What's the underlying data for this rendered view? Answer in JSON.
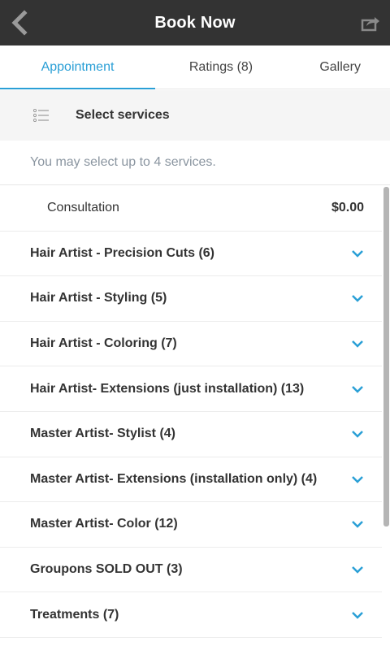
{
  "header": {
    "title": "Book Now"
  },
  "tabs": [
    {
      "label": "Appointment",
      "active": true
    },
    {
      "label": "Ratings (8)",
      "active": false
    },
    {
      "label": "Gallery",
      "active": false
    }
  ],
  "section": {
    "label": "Select services"
  },
  "hint": "You may select up to 4 services.",
  "consultation": {
    "name": "Consultation",
    "price": "$0.00"
  },
  "groups": [
    {
      "label": "Hair Artist - Precision Cuts (6)"
    },
    {
      "label": "Hair Artist - Styling (5)"
    },
    {
      "label": "Hair Artist - Coloring (7)"
    },
    {
      "label": "Hair Artist- Extensions (just installation) (13)"
    },
    {
      "label": "Master Artist- Stylist (4)"
    },
    {
      "label": "Master Artist- Extensions (installation only) (4)"
    },
    {
      "label": "Master Artist- Color (12)"
    },
    {
      "label": "Groupons SOLD OUT (3)"
    },
    {
      "label": "Treatments (7)"
    }
  ],
  "colors": {
    "header_bg": "#333333",
    "accent": "#2a9fd6",
    "section_bg": "#f5f5f5"
  }
}
